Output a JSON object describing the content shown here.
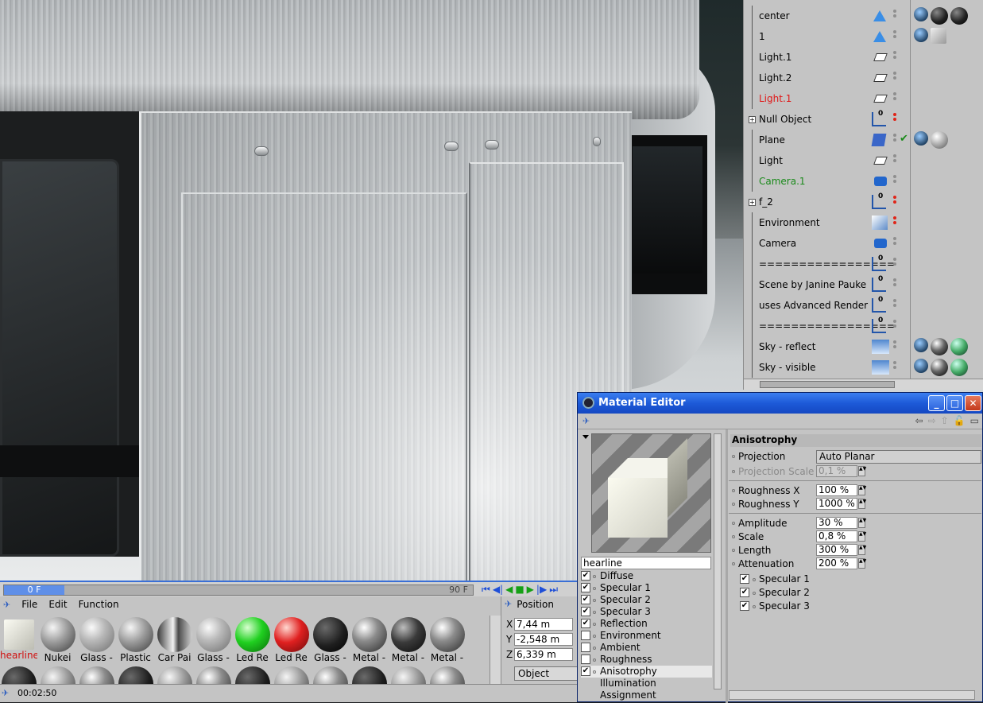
{
  "object_manager": {
    "objects": [
      {
        "name": "center",
        "color": "#000000",
        "icon": "cone-icon",
        "tags": [
          "teapot",
          "mat-dark",
          "mat-dark"
        ]
      },
      {
        "name": "1",
        "color": "#000000",
        "icon": "cone-icon",
        "tags": [
          "teapot",
          "cube"
        ]
      },
      {
        "name": "Light.1",
        "color": "#000000",
        "icon": "light-icon",
        "tags": []
      },
      {
        "name": "Light.2",
        "color": "#000000",
        "icon": "light-icon",
        "tags": []
      },
      {
        "name": "Light.1",
        "color": "#e01818",
        "icon": "light-icon",
        "tags": []
      },
      {
        "name": "Null Object",
        "color": "#000000",
        "icon": "null-icon",
        "tags": []
      },
      {
        "name": "Plane",
        "color": "#000000",
        "icon": "plane-icon",
        "tags": [
          "teapot",
          "mat-grey"
        ]
      },
      {
        "name": "Light",
        "color": "#000000",
        "icon": "light-icon",
        "tags": []
      },
      {
        "name": "Camera.1",
        "color": "#1a8a1a",
        "icon": "camera-icon",
        "tags": []
      },
      {
        "name": "f_2",
        "color": "#000000",
        "icon": "null-icon",
        "tags": []
      },
      {
        "name": "Environment",
        "color": "#000000",
        "icon": "environment-icon",
        "tags": []
      },
      {
        "name": "Camera",
        "color": "#000000",
        "icon": "camera-icon",
        "tags": []
      },
      {
        "name": "=================",
        "color": "#000000",
        "icon": "null-icon",
        "tags": []
      },
      {
        "name": "Scene by Janine Pauke",
        "color": "#000000",
        "icon": "null-icon",
        "tags": []
      },
      {
        "name": "uses Advanced Render",
        "color": "#000000",
        "icon": "null-icon",
        "tags": []
      },
      {
        "name": "=================",
        "color": "#000000",
        "icon": "null-icon",
        "tags": []
      },
      {
        "name": "Sky - reflect",
        "color": "#000000",
        "icon": "sky-icon",
        "tags": [
          "teapot",
          "mat-sky",
          "mat-green"
        ]
      },
      {
        "name": "Sky - visible",
        "color": "#000000",
        "icon": "sky-icon",
        "tags": [
          "teapot",
          "mat-sky",
          "mat-green"
        ]
      }
    ]
  },
  "timeline": {
    "current_frame": "0 F",
    "end_frame": "90 F"
  },
  "material_manager": {
    "menu": [
      "File",
      "Edit",
      "Function"
    ],
    "materials": [
      {
        "label": "hearline",
        "style": "cube",
        "selected": true
      },
      {
        "label": "Nukei",
        "style": "grey"
      },
      {
        "label": "Glass -",
        "style": "glass"
      },
      {
        "label": "Plastic",
        "style": "grey"
      },
      {
        "label": "Car Pai",
        "style": "chrome"
      },
      {
        "label": "Glass -",
        "style": "glass"
      },
      {
        "label": "Led Re",
        "style": "green"
      },
      {
        "label": "Led Re",
        "style": "red"
      },
      {
        "label": "Glass -",
        "style": "dark"
      },
      {
        "label": "Metal -",
        "style": "metal"
      },
      {
        "label": "Metal -",
        "style": "darkmetal"
      },
      {
        "label": "Metal -",
        "style": "metal"
      }
    ]
  },
  "coordinates": {
    "title": "Position",
    "x": "7,44 m",
    "y": "-2,548 m",
    "z": "6,339 m",
    "mode": "Object"
  },
  "status": {
    "time": "00:02:50"
  },
  "material_editor": {
    "title": "Material Editor",
    "material_name": "hearline",
    "channels": [
      {
        "label": "Diffuse",
        "checked": true
      },
      {
        "label": "Specular 1",
        "checked": true
      },
      {
        "label": "Specular 2",
        "checked": true
      },
      {
        "label": "Specular 3",
        "checked": true
      },
      {
        "label": "Reflection",
        "checked": true
      },
      {
        "label": "Environment",
        "checked": false
      },
      {
        "label": "Ambient",
        "checked": false
      },
      {
        "label": "Roughness",
        "checked": false
      },
      {
        "label": "Anisotrophy",
        "checked": true,
        "selected": true
      },
      {
        "label": "Illumination",
        "checked": null
      },
      {
        "label": "Assignment",
        "checked": null
      }
    ],
    "section_title": "Anisotrophy",
    "projection_label": "Projection",
    "projection_value": "Auto Planar",
    "projection_scale_label": "Projection Scale",
    "projection_scale_value": "0,1 %",
    "roughness_x_label": "Roughness X",
    "roughness_x_value": "100 %",
    "roughness_y_label": "Roughness Y",
    "roughness_y_value": "1000 %",
    "amplitude_label": "Amplitude",
    "amplitude_value": "30 %",
    "scale_label": "Scale",
    "scale_value": "0,8 %",
    "length_label": "Length",
    "length_value": "300 %",
    "attenuation_label": "Attenuation",
    "attenuation_value": "200 %",
    "specular_checks": [
      {
        "label": "Specular 1",
        "checked": true
      },
      {
        "label": "Specular 2",
        "checked": true
      },
      {
        "label": "Specular 3",
        "checked": true
      }
    ],
    "window_buttons": {
      "minimize": "_",
      "maximize": "□",
      "close": "✕"
    }
  }
}
